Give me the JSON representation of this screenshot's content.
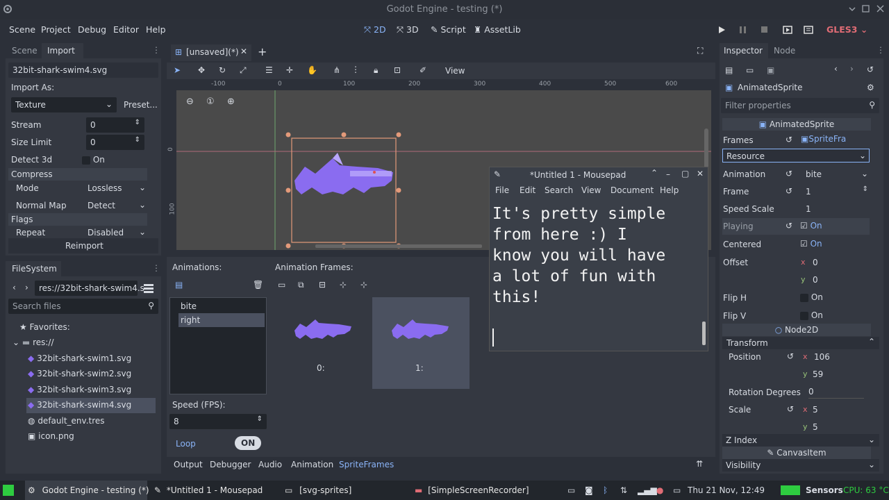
{
  "window": {
    "title": "Godot Engine - testing (*)"
  },
  "menubar": {
    "items": [
      "Scene",
      "Project",
      "Debug",
      "Editor",
      "Help"
    ],
    "workspaces": [
      "2D",
      "3D",
      "Script",
      "AssetLib"
    ],
    "renderer": "GLES3"
  },
  "import_dock": {
    "tabs": [
      "Scene",
      "Import"
    ],
    "file": "32bit-shark-swim4.svg",
    "import_as_label": "Import As:",
    "import_as_value": "Texture",
    "preset_label": "Preset...",
    "props": [
      {
        "label": "Stream",
        "value": "0"
      },
      {
        "label": "Size Limit",
        "value": "0"
      },
      {
        "label": "Detect 3d",
        "value": "On"
      }
    ],
    "compress_label": "Compress",
    "mode_label": "Mode",
    "mode_value": "Lossless",
    "normal_map_label": "Normal Map",
    "normal_map_value": "Detect",
    "flags_label": "Flags",
    "repeat_label": "Repeat",
    "repeat_value": "Disabled",
    "reimport_label": "Reimport"
  },
  "filesystem": {
    "title": "FileSystem",
    "path": "res://32bit-shark-swim4.s",
    "search_placeholder": "Search files",
    "favorites": "Favorites:",
    "root": "res://",
    "files": [
      "32bit-shark-swim1.svg",
      "32bit-shark-swim2.svg",
      "32bit-shark-swim3.svg",
      "32bit-shark-swim4.svg",
      "default_env.tres",
      "icon.png"
    ]
  },
  "editor": {
    "tab": "[unsaved](*)",
    "view_menu": "View",
    "ruler": [
      "-100",
      "0",
      "100",
      "200",
      "300",
      "400",
      "500",
      "600"
    ],
    "vruler": [
      "0",
      "100"
    ]
  },
  "sprite_frames": {
    "animations_label": "Animations:",
    "frames_label": "Animation Frames:",
    "animations": [
      "bite",
      "right"
    ],
    "selected_animation": "right",
    "frames": [
      "0:",
      "1:"
    ],
    "speed_label": "Speed (FPS):",
    "speed_value": "8",
    "loop_label": "Loop",
    "loop_toggle": "ON"
  },
  "bottom_tabs": [
    "Output",
    "Debugger",
    "Audio",
    "Animation",
    "SpriteFrames"
  ],
  "mousepad": {
    "title": "*Untitled 1 - Mousepad",
    "menu": [
      "File",
      "Edit",
      "Search",
      "View",
      "Document",
      "Help"
    ],
    "text": "It's pretty simple\nfrom here :) I\nknow you will have\na lot of fun with\nthis!"
  },
  "inspector": {
    "tabs": [
      "Inspector",
      "Node"
    ],
    "node_name": "AnimatedSprite",
    "filter_placeholder": "Filter properties",
    "class_header": "AnimatedSprite",
    "frames_label": "Frames",
    "frames_value": "SpriteFra",
    "resource_label": "Resource",
    "animation_label": "Animation",
    "animation_value": "bite",
    "frame_label": "Frame",
    "frame_value": "1",
    "speed_scale_label": "Speed Scale",
    "speed_scale_value": "1",
    "playing_label": "Playing",
    "playing_value": "On",
    "centered_label": "Centered",
    "centered_value": "On",
    "offset_label": "Offset",
    "offset_x_axis": "x",
    "offset_y_axis": "y",
    "offset_x": "0",
    "offset_y": "0",
    "flip_h_label": "Flip H",
    "flip_h_value": "On",
    "flip_v_label": "Flip V",
    "flip_v_value": "On",
    "node2d_header": "Node2D",
    "transform_label": "Transform",
    "position_label": "Position",
    "pos_x_axis": "x",
    "pos_y_axis": "y",
    "pos_x": "106",
    "pos_y": "59",
    "rotation_label": "Rotation Degrees",
    "rotation_value": "0",
    "scale_label": "Scale",
    "scale_x_axis": "x",
    "scale_y_axis": "y",
    "scale_x": "5",
    "scale_y": "5",
    "zindex_label": "Z Index",
    "canvasitem_header": "CanvasItem",
    "visibility_label": "Visibility"
  },
  "taskbar": {
    "tasks": [
      "Godot Engine - testing (*)",
      "*Untitled 1 - Mousepad",
      "[svg-sprites]",
      "[SimpleScreenRecorder]"
    ],
    "clock": "Thu 21 Nov, 12:49",
    "sensors": "Sensors",
    "cpu": "CPU: 63 °C"
  },
  "colors": {
    "accent": "#8ab4f8",
    "shark": "#8a6cf0",
    "taskbar_green": "#2ecc40"
  }
}
